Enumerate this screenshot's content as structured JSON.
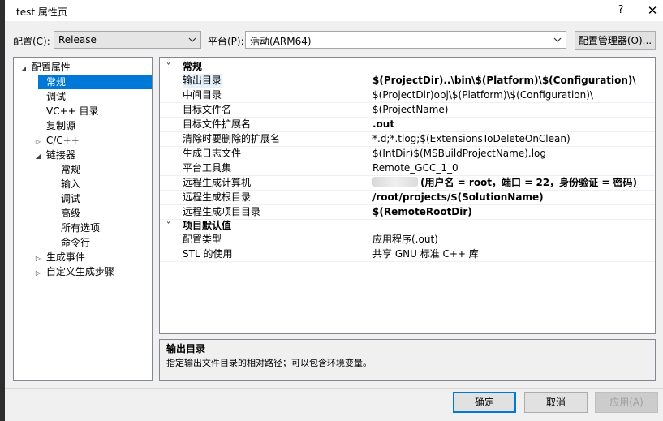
{
  "window": {
    "title": "test 属性页",
    "help": "?",
    "close": "✕"
  },
  "toolbar": {
    "config_label": "配置(C):",
    "config_value": "Release",
    "platform_label": "平台(P):",
    "platform_value": "活动(ARM64)",
    "config_manager": "配置管理器(O)..."
  },
  "tree": {
    "items": [
      {
        "label": "配置属性",
        "expander": "◢"
      },
      {
        "label": "常规",
        "expander": ""
      },
      {
        "label": "调试",
        "expander": ""
      },
      {
        "label": "VC++ 目录",
        "expander": ""
      },
      {
        "label": "复制源",
        "expander": ""
      },
      {
        "label": "C/C++",
        "expander": "▷"
      },
      {
        "label": "链接器",
        "expander": "◢"
      },
      {
        "label": "常规",
        "expander": ""
      },
      {
        "label": "输入",
        "expander": ""
      },
      {
        "label": "调试",
        "expander": ""
      },
      {
        "label": "高级",
        "expander": ""
      },
      {
        "label": "所有选项",
        "expander": ""
      },
      {
        "label": "命令行",
        "expander": ""
      },
      {
        "label": "生成事件",
        "expander": "▷"
      },
      {
        "label": "自定义生成步骤",
        "expander": "▷"
      }
    ]
  },
  "grid": {
    "categories": [
      {
        "title": "常规",
        "chevron": "˅"
      },
      {
        "title": "项目默认值",
        "chevron": "˅"
      }
    ],
    "general": [
      {
        "name": "输出目录",
        "value": "$(ProjectDir)..\\bin\\$(Platform)\\$(Configuration)\\"
      },
      {
        "name": "中间目录",
        "value": "$(ProjectDir)obj\\$(Platform)\\$(Configuration)\\"
      },
      {
        "name": "目标文件名",
        "value": "$(ProjectName)"
      },
      {
        "name": "目标文件扩展名",
        "value": ".out"
      },
      {
        "name": "清除时要删除的扩展名",
        "value": "*.d;*.tlog;$(ExtensionsToDeleteOnClean)"
      },
      {
        "name": "生成日志文件",
        "value": "$(IntDir)$(MSBuildProjectName).log"
      },
      {
        "name": "平台工具集",
        "value": "Remote_GCC_1_0"
      },
      {
        "name": "远程生成计算机",
        "value": "(用户名 = root，端口 = 22，身份验证 = 密码)"
      },
      {
        "name": "远程生成根目录",
        "value": "/root/projects/$(SolutionName)"
      },
      {
        "name": "远程生成项目目录",
        "value": "$(RemoteRootDir)"
      }
    ],
    "defaults": [
      {
        "name": "配置类型",
        "value": "应用程序(.out)"
      },
      {
        "name": "STL 的使用",
        "value": "共享 GNU 标准 C++ 库"
      }
    ]
  },
  "description": {
    "title": "输出目录",
    "text": "指定输出文件目录的相对路径；可以包含环境变量。"
  },
  "buttons": {
    "ok": "确定",
    "cancel": "取消",
    "apply": "应用(A)"
  },
  "colors": {
    "selection": "#0078d7",
    "window_bg": "#f0f0f0"
  }
}
